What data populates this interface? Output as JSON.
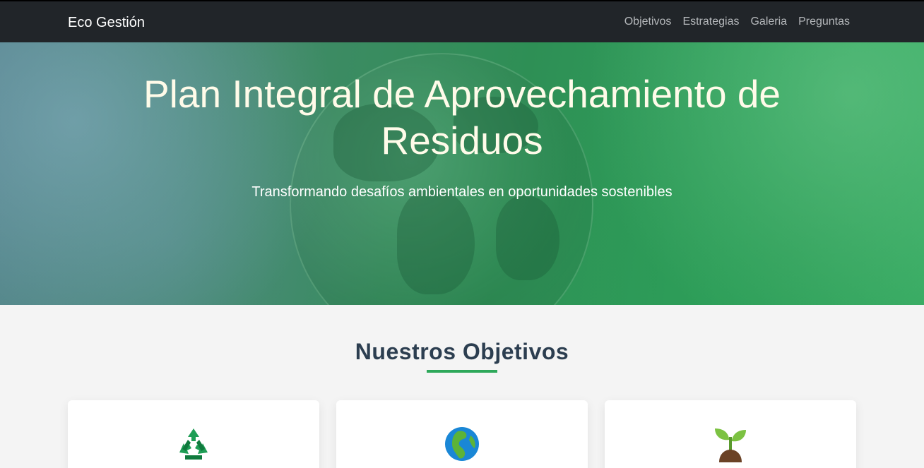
{
  "navbar": {
    "brand": "Eco Gestión",
    "links": [
      "Objetivos",
      "Estrategias",
      "Galeria",
      "Preguntas"
    ]
  },
  "hero": {
    "title": "Plan Integral de Aprovechamiento de Residuos",
    "subtitle": "Transformando desafíos ambientales en oportunidades sostenibles"
  },
  "objectives": {
    "title": "Nuestros Objetivos",
    "cards": [
      {
        "icon": "recycle-icon"
      },
      {
        "icon": "earth-globe-icon"
      },
      {
        "icon": "seedling-icon"
      }
    ]
  },
  "colors": {
    "navbar_bg": "#212529",
    "accent": "#2ea85a",
    "heading": "#2c3e50"
  }
}
